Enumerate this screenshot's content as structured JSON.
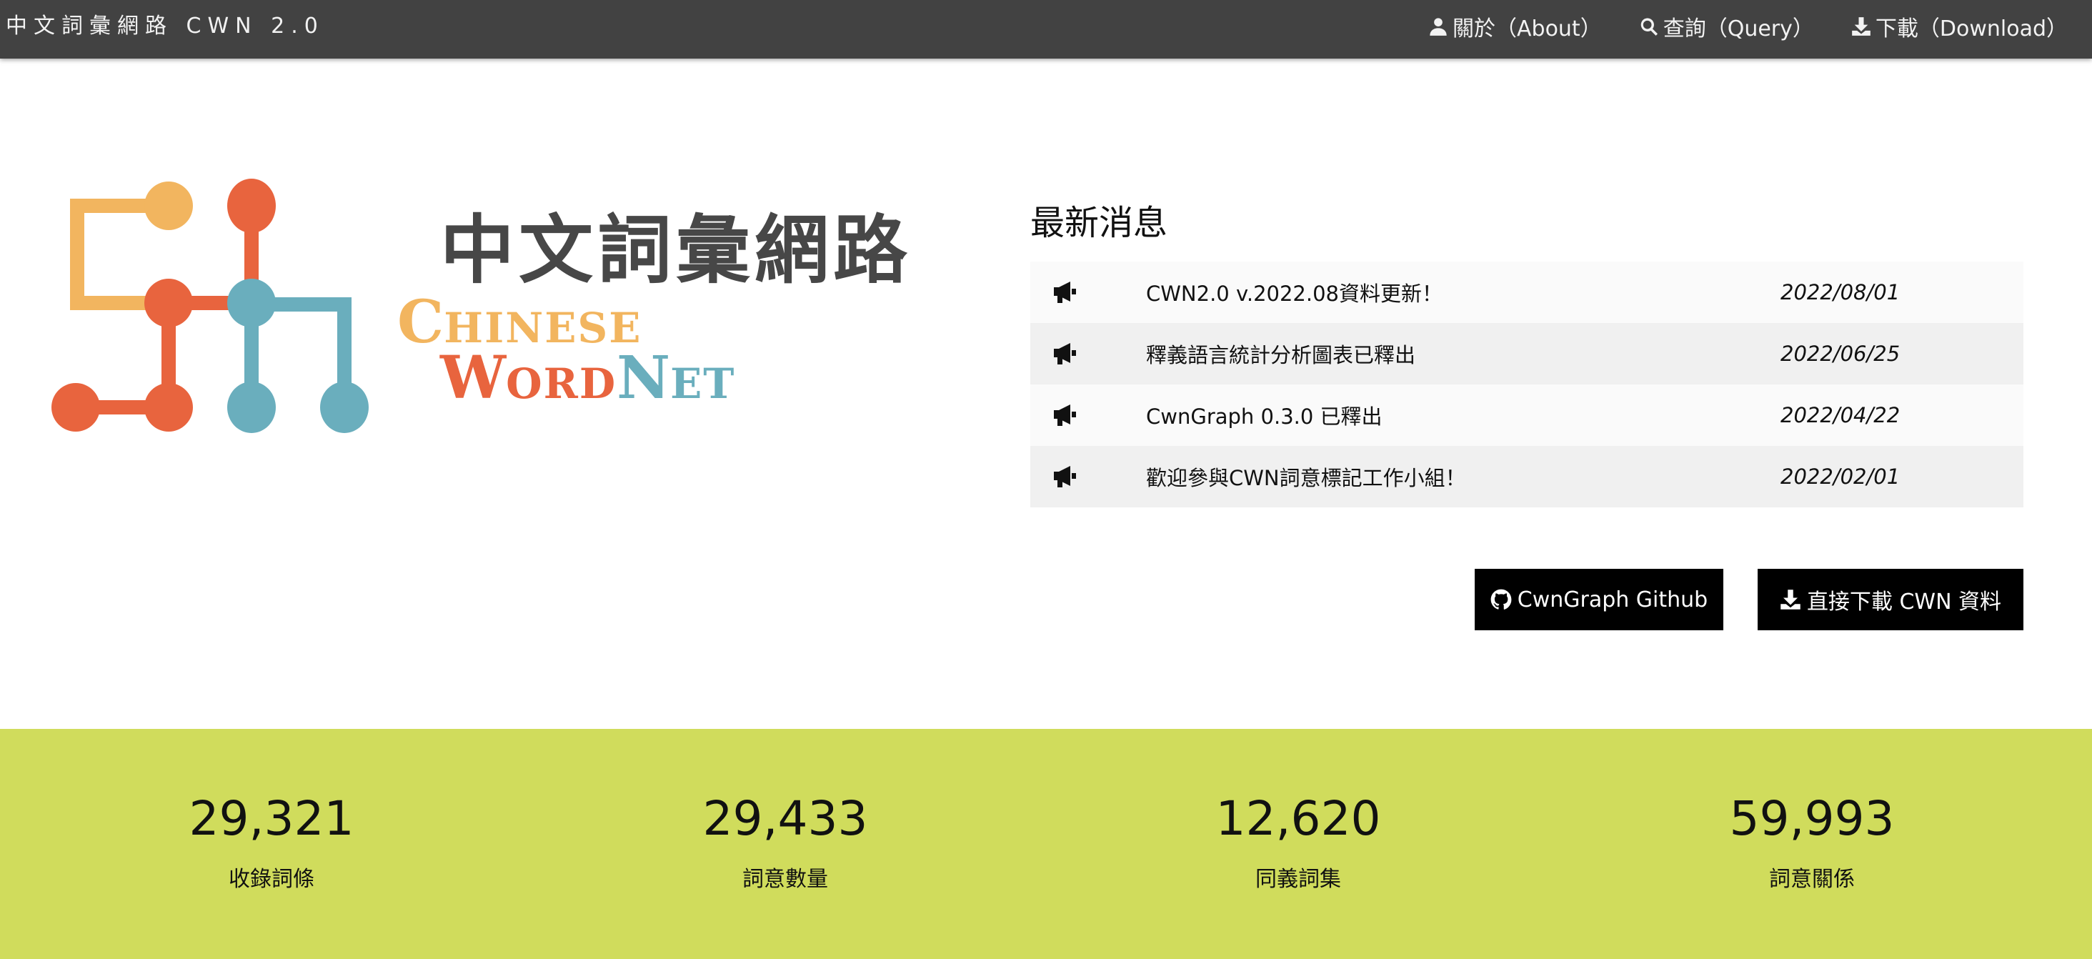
{
  "nav": {
    "brand": "中文詞彙網路 CWN 2.0",
    "links": [
      {
        "label": "關於（About）",
        "icon": "user-icon"
      },
      {
        "label": "查詢（Query）",
        "icon": "search-icon"
      },
      {
        "label": "下載（Download）",
        "icon": "download-icon"
      }
    ]
  },
  "logo": {
    "zh": "中文詞彙網路",
    "en_line1": {
      "cap": "C",
      "rest": "HINESE"
    },
    "en_line2": {
      "cap1": "W",
      "rest1": "ORD",
      "cap2": "N",
      "rest2": "ET"
    },
    "colors": {
      "yellow": "#f2b55f",
      "red": "#e8643e",
      "teal": "#6aaebd",
      "gray": "#474747"
    }
  },
  "news": {
    "title": "最新消息",
    "items": [
      {
        "text": "CWN2.0 v.2022.08資料更新！",
        "date": "2022/08/01",
        "icon": "megaphone-icon"
      },
      {
        "text": "釋義語言統計分析圖表已釋出",
        "date": "2022/06/25",
        "icon": "megaphone-icon"
      },
      {
        "text": "CwnGraph 0.3.0 已釋出",
        "date": "2022/04/22",
        "icon": "megaphone-icon"
      },
      {
        "text": "歡迎參與CWN詞意標記工作小組！",
        "date": "2022/02/01",
        "icon": "megaphone-icon"
      }
    ]
  },
  "buttons": {
    "github": {
      "label": "CwnGraph Github",
      "icon": "github-icon"
    },
    "download": {
      "label": "直接下載 CWN 資料",
      "icon": "download-icon"
    }
  },
  "stats": {
    "background": "#d0dc5c",
    "items": [
      {
        "value": "29,321",
        "label": "收錄詞條"
      },
      {
        "value": "29,433",
        "label": "詞意數量"
      },
      {
        "value": "12,620",
        "label": "同義詞集"
      },
      {
        "value": "59,993",
        "label": "詞意關係"
      }
    ]
  }
}
